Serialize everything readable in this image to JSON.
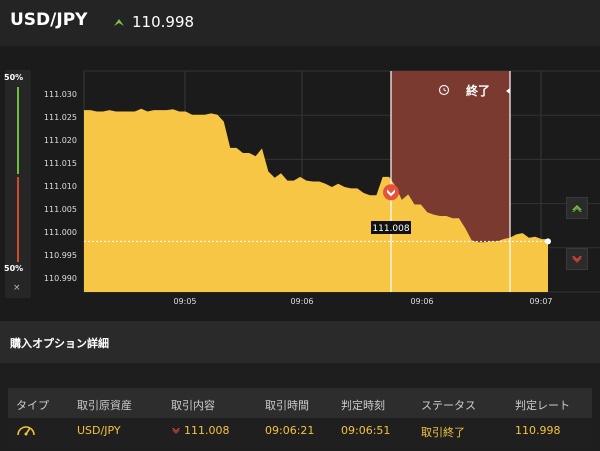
{
  "header": {
    "pair": "USD/JPY",
    "current_price": "110.998",
    "direction_icon": "up-triangle-icon",
    "up_color": "#7cc242"
  },
  "gauge": {
    "top_label": "50%",
    "bottom_label": "50%",
    "high_share": 0.5,
    "low_share": 0.5,
    "close_glyph": "×"
  },
  "chart": {
    "y_ticks": [
      "111.030",
      "111.025",
      "111.020",
      "111.015",
      "111.010",
      "111.005",
      "111.000",
      "110.995",
      "110.990"
    ],
    "x_ticks": [
      "09:05",
      "09:06",
      "09:06",
      "09:07"
    ],
    "end_label": "終了",
    "entry_rate_label": "111.008",
    "fill_color": "#f6c644",
    "window_color": "#7a3a30"
  },
  "chart_data": {
    "type": "area",
    "series": [
      {
        "values": [
          111.0265,
          111.0265,
          111.0262,
          111.0262,
          111.0265,
          111.0262,
          111.0262,
          111.0262,
          111.0262,
          111.0268,
          111.0262,
          111.0265,
          111.0265,
          111.0265,
          111.0267,
          111.0262,
          111.0262,
          111.0255,
          111.0255,
          111.0255,
          111.0258,
          111.0255,
          111.024,
          111.0183,
          111.0183,
          111.0172,
          111.0172,
          111.0165,
          111.0182,
          111.0132,
          111.0118,
          111.0128,
          111.0112,
          111.0112,
          111.012,
          111.0112,
          111.011,
          111.011,
          111.0105,
          111.0098,
          111.0105,
          111.0098,
          111.0095,
          111.0095,
          111.0085,
          111.008,
          111.008,
          111.012,
          111.012,
          111.01,
          111.007,
          111.0082,
          111.006,
          111.006,
          111.0043,
          111.0038,
          111.0035,
          111.0035,
          111.003,
          111.003,
          111.0008,
          110.9982,
          110.9978,
          110.9978,
          110.998,
          110.998,
          110.9985,
          110.9988,
          110.9995,
          110.9998,
          110.9988,
          110.999,
          110.9985,
          110.9985
        ]
      }
    ],
    "x_tick_labels": [
      "09:05",
      "09:06",
      "09:06",
      "09:07"
    ],
    "ylim": [
      110.987,
      111.035
    ],
    "current_rate": 110.998,
    "grid": true
  },
  "side_buttons": {
    "high_icon": "up-chevron-icon",
    "low_icon": "down-chevron-icon"
  },
  "details": {
    "title": "購入オプション詳細",
    "columns": [
      "タイプ",
      "取引原資産",
      "取引内容",
      "取引時間",
      "判定時刻",
      "ステータス",
      "判定レート"
    ],
    "row": {
      "type_icon": "gauge-icon",
      "asset": "USD/JPY",
      "trade": "111.008",
      "trade_icon": "down-chevron-icon",
      "trade_time": "09:06:21",
      "judge_time": "09:06:51",
      "status": "取引終了",
      "judge_rate": "110.998"
    }
  }
}
